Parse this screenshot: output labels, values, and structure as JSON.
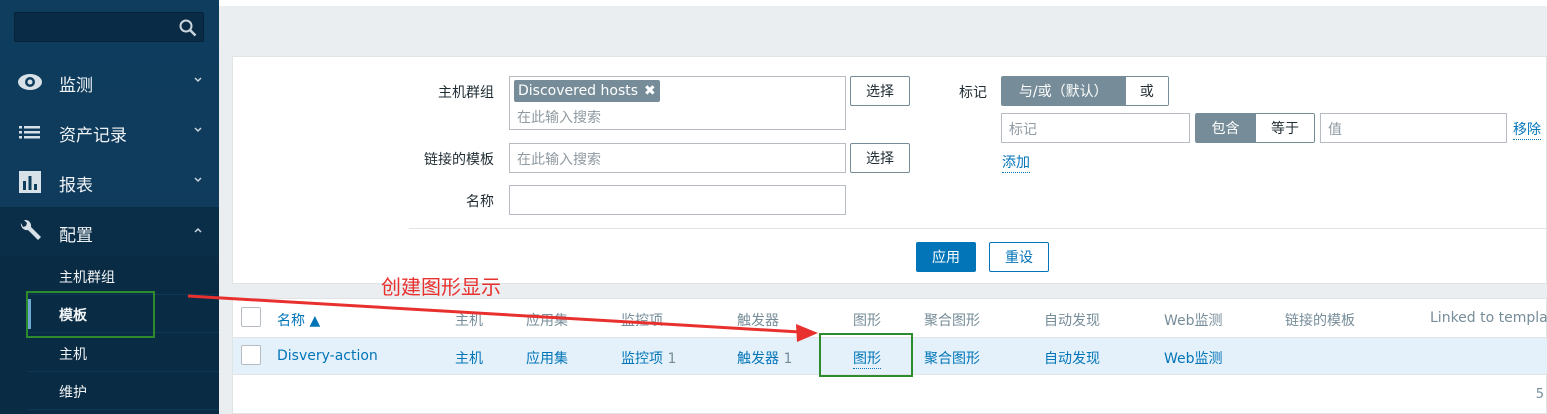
{
  "sidebar": {
    "search": {
      "placeholder": ""
    },
    "items": [
      {
        "label": "监测",
        "icon": "eye-icon"
      },
      {
        "label": "资产记录",
        "icon": "list-icon"
      },
      {
        "label": "报表",
        "icon": "chart-icon"
      },
      {
        "label": "配置",
        "icon": "wrench-icon"
      }
    ],
    "subitems": [
      {
        "label": "主机群组"
      },
      {
        "label": "模板"
      },
      {
        "label": "主机"
      },
      {
        "label": "维护"
      }
    ]
  },
  "filter": {
    "host_groups": {
      "label": "主机群组",
      "chip": "Discovered hosts",
      "placeholder": "在此输入搜索",
      "select_button": "选择"
    },
    "linked_templates": {
      "label": "链接的模板",
      "placeholder": "在此输入搜索",
      "select_button": "选择"
    },
    "name": {
      "label": "名称",
      "value": ""
    },
    "tags": {
      "label": "标记",
      "mode_and_or": "与/或（默认）",
      "mode_or": "或",
      "tag_placeholder": "标记",
      "op_contains": "包含",
      "op_equals": "等于",
      "value_placeholder": "值",
      "remove": "移除",
      "add": "添加"
    },
    "apply_button": "应用",
    "reset_button": "重设"
  },
  "table": {
    "headers": {
      "name": "名称 ▲",
      "hosts": "主机",
      "applications": "应用集",
      "items": "监控项",
      "triggers": "触发器",
      "graphs": "图形",
      "screens": "聚合图形",
      "discovery": "自动发现",
      "web": "Web监测",
      "linked_templates": "链接的模板",
      "linked_to": "Linked to template"
    },
    "rows": [
      {
        "name": "Disvery-action",
        "hosts": "主机",
        "applications": "应用集",
        "items": "监控项",
        "items_count": "1",
        "triggers": "触发器",
        "triggers_count": "1",
        "graphs": "图形",
        "screens": "聚合图形",
        "discovery": "自动发现",
        "web": "Web监测"
      }
    ],
    "pager_tail": "5"
  },
  "annotation": {
    "text": "创建图形显示",
    "color": "#e8312f",
    "box_color": "#2d8a2d"
  }
}
